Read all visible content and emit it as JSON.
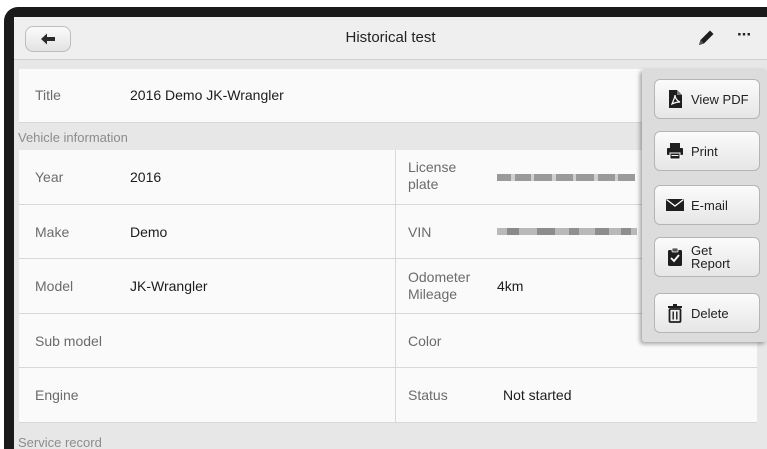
{
  "header": {
    "title": "Historical test"
  },
  "record": {
    "title_label": "Title",
    "title_value": "2016 Demo JK-Wrangler"
  },
  "vehicle_section_label": "Vehicle information",
  "vehicle": {
    "year_label": "Year",
    "year_value": "2016",
    "license_label": "License plate",
    "make_label": "Make",
    "make_value": "Demo",
    "vin_label": "VIN",
    "model_label": "Model",
    "model_value": "JK-Wrangler",
    "odometer_label": "Odometer Mileage",
    "odometer_value": "4km",
    "submodel_label": "Sub model",
    "color_label": "Color",
    "engine_label": "Engine",
    "status_label": "Status",
    "status_value": "Not started"
  },
  "service_section_label": "Service record",
  "menu": {
    "view_pdf": "View PDF",
    "print": "Print",
    "email": "E-mail",
    "get_report": "Get Report",
    "delete": "Delete"
  },
  "icons": {
    "back": "back-arrow-icon",
    "edit": "pencil-icon",
    "more": "more-icon",
    "pdf": "pdf-icon",
    "print": "printer-icon",
    "email": "envelope-icon",
    "report": "clipboard-icon",
    "delete": "trash-icon"
  }
}
